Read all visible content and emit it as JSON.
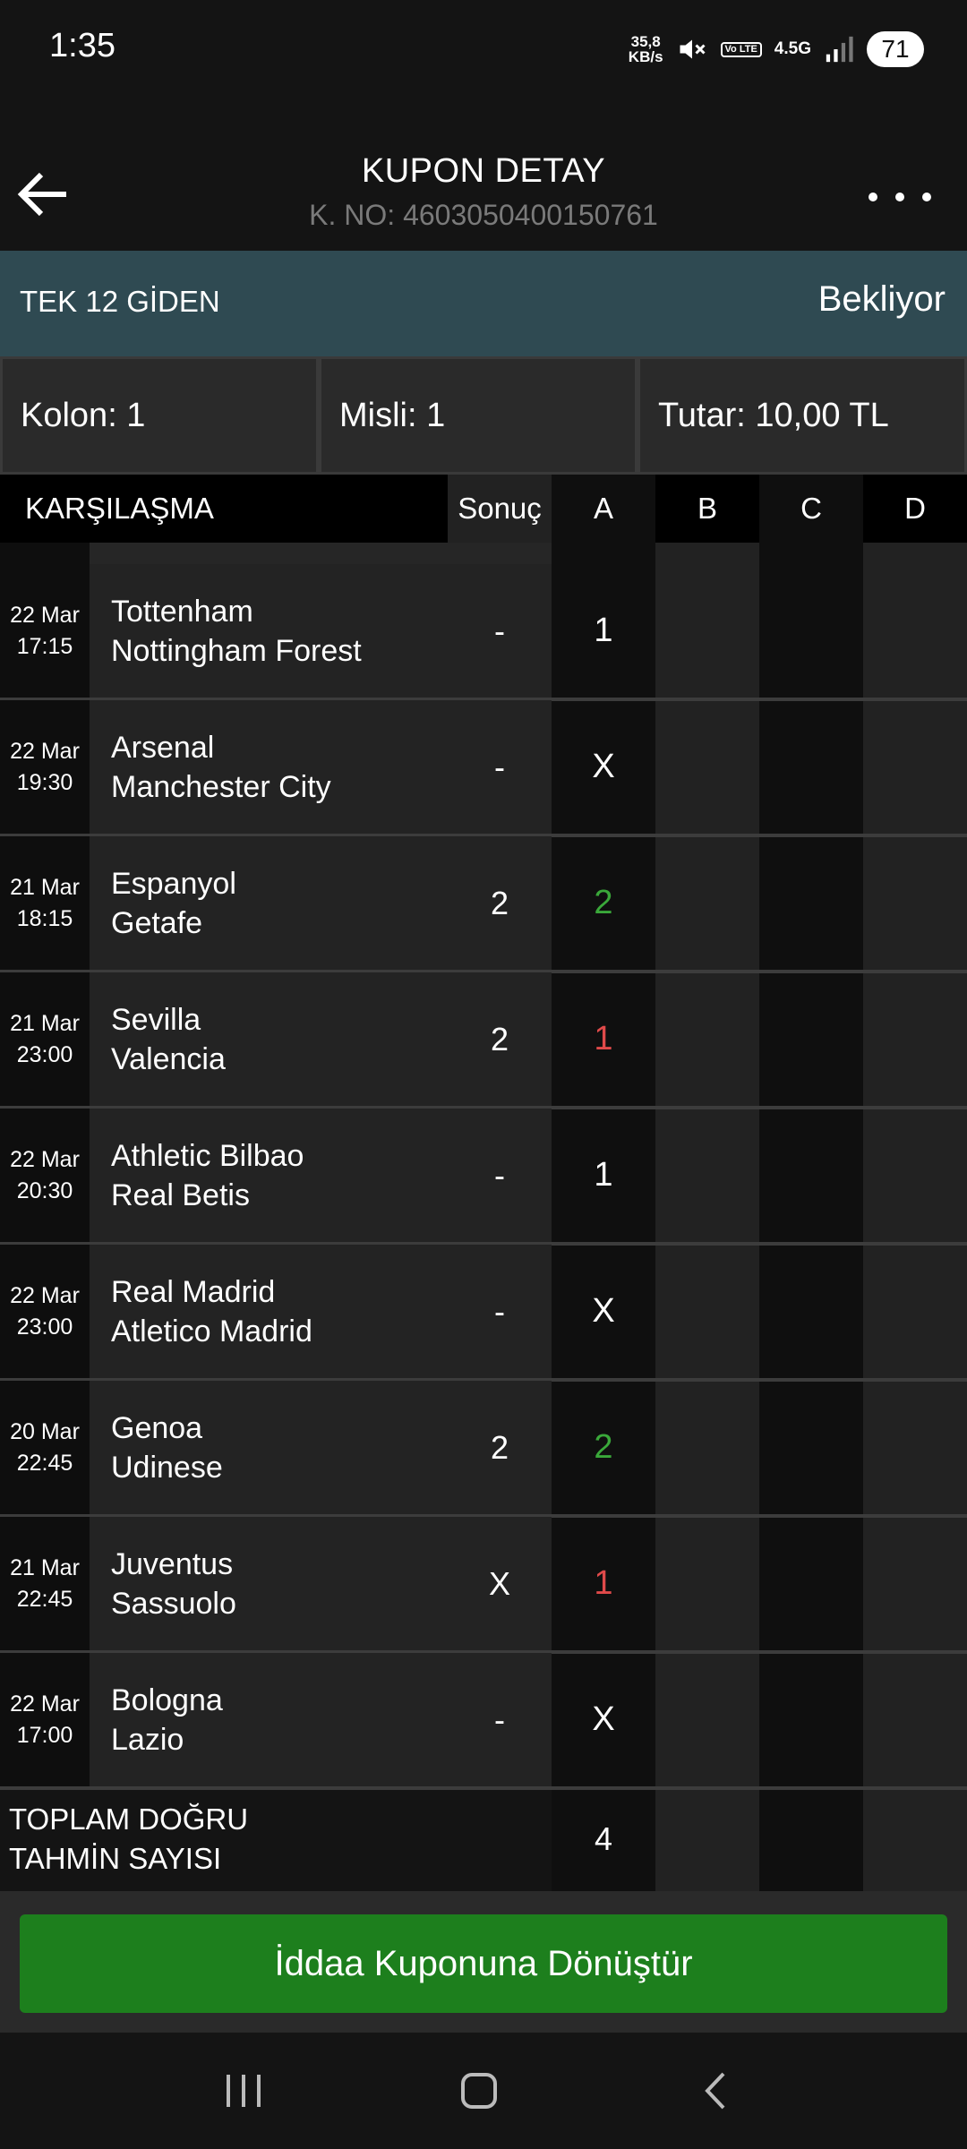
{
  "status_bar": {
    "time": "1:35",
    "net_speed_value": "35,8",
    "net_speed_unit": "KB/s",
    "volte": "Vo LTE",
    "network": "4.5G",
    "battery": "71"
  },
  "header": {
    "title": "KUPON DETAY",
    "coupon_no": "K. NO: 4603050400150761"
  },
  "banner": {
    "type": "TEK 12 GİDEN",
    "status": "Bekliyor"
  },
  "info": {
    "kolon": "Kolon: 1",
    "misli": "Misli: 1",
    "tutar": "Tutar: 10,00 TL"
  },
  "table": {
    "headers": {
      "match": "KARŞILAŞMA",
      "result": "Sonuç",
      "a": "A",
      "b": "B",
      "c": "C",
      "d": "D"
    },
    "rows": [
      {
        "date": "22 Mar",
        "time": "17:15",
        "home": "Tottenham",
        "away": "Nottingham Forest",
        "result": "-",
        "pred": "1",
        "state": "pending"
      },
      {
        "date": "22 Mar",
        "time": "19:30",
        "home": "Arsenal",
        "away": "Manchester City",
        "result": "-",
        "pred": "X",
        "state": "pending"
      },
      {
        "date": "21 Mar",
        "time": "18:15",
        "home": "Espanyol",
        "away": "Getafe",
        "result": "2",
        "pred": "2",
        "state": "correct"
      },
      {
        "date": "21 Mar",
        "time": "23:00",
        "home": "Sevilla",
        "away": "Valencia",
        "result": "2",
        "pred": "1",
        "state": "wrong"
      },
      {
        "date": "22 Mar",
        "time": "20:30",
        "home": "Athletic Bilbao",
        "away": "Real Betis",
        "result": "-",
        "pred": "1",
        "state": "pending"
      },
      {
        "date": "22 Mar",
        "time": "23:00",
        "home": "Real Madrid",
        "away": "Atletico Madrid",
        "result": "-",
        "pred": "X",
        "state": "pending"
      },
      {
        "date": "20 Mar",
        "time": "22:45",
        "home": "Genoa",
        "away": "Udinese",
        "result": "2",
        "pred": "2",
        "state": "correct"
      },
      {
        "date": "21 Mar",
        "time": "22:45",
        "home": "Juventus",
        "away": "Sassuolo",
        "result": "X",
        "pred": "1",
        "state": "wrong"
      },
      {
        "date": "22 Mar",
        "time": "17:00",
        "home": "Bologna",
        "away": "Lazio",
        "result": "-",
        "pred": "X",
        "state": "pending"
      }
    ],
    "total_label_line1": "TOPLAM DOĞRU",
    "total_label_line2": "TAHMİN SAYISI",
    "total_value": "4"
  },
  "convert_button": "İddaa Kuponuna Dönüştür",
  "colors": {
    "correct": "#3aa83a",
    "wrong": "#e04a4a",
    "pending": "#ffffff",
    "banner": "#2f4a52",
    "button": "#1d7f1d"
  },
  "icons": {
    "back": "arrow-left-icon",
    "more": "more-horizontal-icon",
    "mute": "volume-mute-icon",
    "signal": "signal-icon",
    "nav_recents": "recents-icon",
    "nav_home": "home-icon",
    "nav_back": "chevron-left-icon"
  }
}
